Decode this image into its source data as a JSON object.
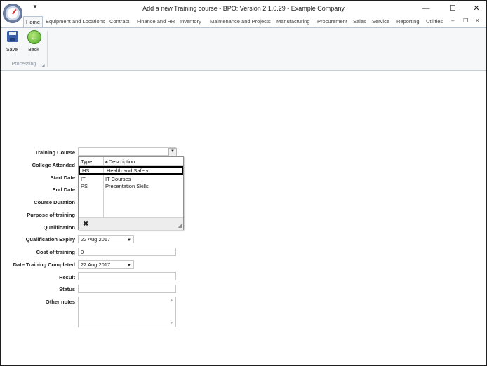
{
  "window": {
    "title": "Add a new Training course - BPO: Version 2.1.0.29 - Example Company",
    "minimize": "—",
    "maximize": "☐",
    "close": "✕"
  },
  "ribbon": {
    "tabs": [
      "Home",
      "Equipment and Locations",
      "Contract",
      "Finance and HR",
      "Inventory",
      "Maintenance and Projects",
      "Manufacturing",
      "Procurement",
      "Sales",
      "Service",
      "Reporting",
      "Utilities"
    ],
    "active_tab": "Home",
    "buttons": {
      "save": "Save",
      "back": "Back"
    },
    "group_label": "Processing"
  },
  "form": {
    "labels": {
      "training_course": "Training Course",
      "college_attended": "College Attended",
      "start_date": "Start Date",
      "end_date": "End Date",
      "course_duration": "Course Duration",
      "purpose_of_training": "Purpose of training",
      "qualification": "Qualification",
      "qualification_expiry": "Qualification Expiry",
      "cost_of_training": "Cost of training",
      "date_training_completed": "Date Training Completed",
      "result": "Result",
      "status": "Status",
      "other_notes": "Other notes"
    },
    "values": {
      "training_course": "",
      "qualification_expiry": "22 Aug 2017",
      "cost_of_training": "0",
      "date_training_completed": "22 Aug 2017",
      "result": "",
      "status": "",
      "other_notes": ""
    }
  },
  "dropdown": {
    "columns": [
      "Type",
      "Description"
    ],
    "rows": [
      {
        "type": "HS",
        "description": "Health and Safety",
        "selected": true
      },
      {
        "type": "IT",
        "description": "IT Courses",
        "selected": false
      },
      {
        "type": "PS",
        "description": "Presentation Skills",
        "selected": false
      }
    ],
    "close_glyph": "✖"
  }
}
